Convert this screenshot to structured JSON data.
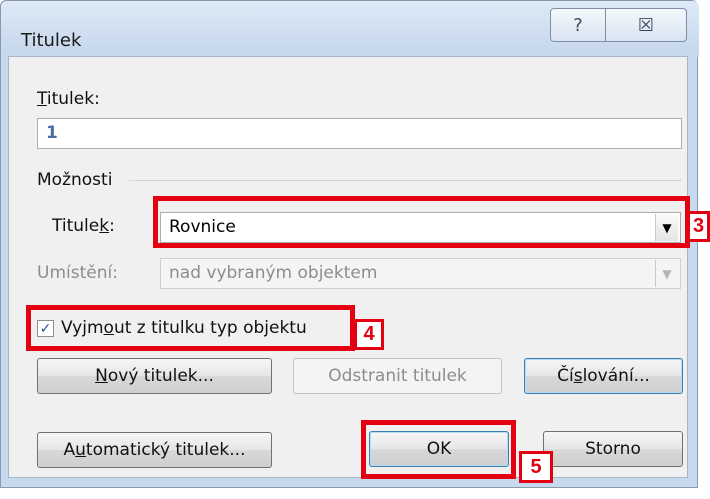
{
  "window": {
    "title": "Titulek",
    "help_symbol": "?",
    "close_symbol": "☒"
  },
  "caption": {
    "label_prefix": "",
    "label_key": "T",
    "label_rest": "itulek:",
    "value": "1"
  },
  "options": {
    "group_label": "Možnosti",
    "label_field": {
      "label_prefix": "Tit",
      "label_mid": "ule",
      "label_key": "k",
      "label_rest": ":",
      "value": "Rovnice"
    },
    "position_field": {
      "label": "Umístění:",
      "value": "nad vybraným objektem"
    },
    "exclude_checkbox": {
      "checked": true,
      "check_mark": "✓",
      "label_prefix": "Vyjm",
      "label_key": "o",
      "label_rest": "ut z titulku typ objektu"
    }
  },
  "buttons": {
    "new_label": {
      "prefix": "",
      "key": "N",
      "rest": "ový titulek..."
    },
    "delete_label": {
      "text": "Odstranit titulek"
    },
    "numbering": {
      "prefix": "Čí",
      "key": "s",
      "rest": "lování..."
    },
    "autocaption": {
      "prefix": "A",
      "key": "u",
      "rest": "tomatický titulek..."
    },
    "ok": "OK",
    "cancel": "Storno"
  },
  "annotations": [
    {
      "number": "3"
    },
    {
      "number": "4"
    },
    {
      "number": "5"
    }
  ],
  "colors": {
    "highlight": "#e30010",
    "caption_text": "#4a6fa5"
  },
  "icons": {
    "dropdown": "▼"
  }
}
